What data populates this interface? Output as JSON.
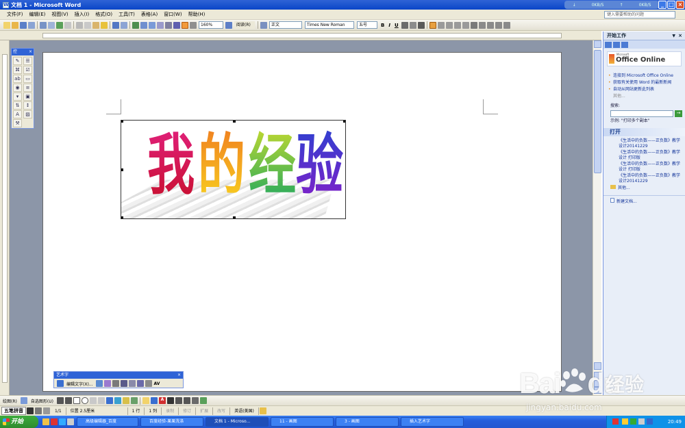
{
  "window": {
    "title": "文档 1 - Microsoft Word",
    "net_up": "0KB/S",
    "net_down": "0KB/S"
  },
  "menu": {
    "items": [
      "文件(F)",
      "编辑(E)",
      "视图(V)",
      "插入(I)",
      "格式(O)",
      "工具(T)",
      "表格(A)",
      "窗口(W)",
      "帮助(H)"
    ],
    "help_placeholder": "键入需要帮助的问题"
  },
  "toolbar": {
    "zoom": "160%",
    "read_label": "阅读(R)",
    "style": "正文",
    "font": "Times New Roman",
    "size": "五号",
    "bold": "B",
    "italic": "I",
    "underline": "U"
  },
  "control_toolbox": {
    "title": "控",
    "icons": [
      "design-mode-icon",
      "properties-icon",
      "view-code-icon",
      "checkbox-icon",
      "textbox-icon",
      "button-icon",
      "option-icon",
      "listbox-icon",
      "combobox-icon",
      "toggle-icon",
      "spin-icon",
      "scrollbar-icon",
      "label-icon",
      "image-icon",
      "more-controls-icon"
    ]
  },
  "wordart": {
    "text": [
      "我",
      "的",
      "经",
      "验"
    ]
  },
  "wordart_toolbar": {
    "title": "艺术字",
    "edit_label": "编辑文字(X)...",
    "spacing_label": "AV"
  },
  "task_pane": {
    "title": "开始工作",
    "office_online": "Office Online",
    "microsoft_label": "Microsoft",
    "links": [
      "连接到 Microsoft Office Online",
      "获取有关使用 Word 的最新新闻",
      "自动从网站更新此列表"
    ],
    "more": "其他...",
    "search_label": "搜索:",
    "example": "示例:  \"打印多个副本\"",
    "open_heading": "打开",
    "files": [
      "《生活中的负数——正负数》教学设计20141229",
      "《生活中的负数——正负数》教学设计 打印版",
      "《生活中的负数——正负数》教学设计 打印版",
      "《生活中的负数——正负数》教学设计20141229"
    ],
    "open_more": "其他...",
    "new_doc": "新建文档..."
  },
  "draw_toolbar": {
    "draw_label": "绘图(R)",
    "autoshapes_label": "自选图形(U)"
  },
  "status": {
    "ime": "五笔拼音",
    "page": "1/1",
    "position": "位置 2.5厘米",
    "line": "1 行",
    "col": "1 列",
    "modes": [
      "录制",
      "修订",
      "扩展",
      "改写"
    ],
    "language": "英语(美国)"
  },
  "taskbar": {
    "start": "开始",
    "tasks": [
      "高级编辑器_百度",
      "百度经验-果果洗涤",
      "文档 1 - Microso...",
      "11 - 画图",
      "3 - 画图",
      "插入艺术字"
    ],
    "time": "20:49"
  },
  "watermark": {
    "brand": "Bai",
    "brand2": "du",
    "label": "经验",
    "url": "jingyan.baidu.com"
  }
}
